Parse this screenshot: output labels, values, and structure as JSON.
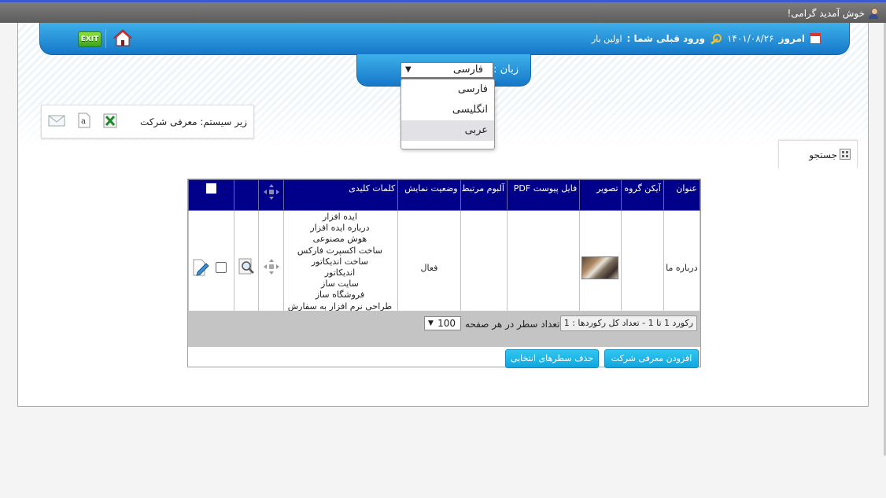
{
  "topbar": {
    "welcome": "خوش آمدید گرامی!"
  },
  "header": {
    "exit_label": "EXIT",
    "today_label": "امروز",
    "date": "۱۴۰۱/۰۸/۲۶",
    "last_login_label": "ورود قبلی شما :",
    "last_login_value": "اولین بار"
  },
  "language": {
    "label": "زبان :",
    "selected": "فارسی",
    "options": [
      "فارسی",
      "انگلیسی",
      "عربی"
    ],
    "highlighted_index": 2
  },
  "subsystem": {
    "text": "زیر سیستم: معرفی شرکت"
  },
  "search_tab": {
    "label": "جستجو"
  },
  "grid": {
    "columns": [
      "عنوان",
      "آیکن گروه",
      "تصویر",
      "فایل پیوست PDF",
      "آلبوم مرتبط",
      "وضعیت نمایش",
      "کلمات کلیدی"
    ],
    "rows": [
      {
        "title": "درباره ما",
        "status": "فعال",
        "keywords": [
          "ایده افزار",
          "درباره ایده افزار",
          "هوش مصنوعی",
          "ساخت اکسپرت فارکس",
          "ساخت اندیکاتور",
          "اندیکاتور",
          "سایت ساز",
          "فروشگاه ساز",
          "طراحی نرم افزار به سفارش مشتری"
        ]
      }
    ]
  },
  "pager": {
    "records_text": "رکورد 1 تا 1 - تعداد کل رکوردها : 1",
    "rows_per_page_label": "تعداد سطر در هر صفحه",
    "rows_per_page_value": "100"
  },
  "actions": {
    "add_label": "افزودن معرفی شرکت",
    "delete_label": "حذف سطرهای انتخابی"
  },
  "colors": {
    "header_blue": "#1678c8",
    "grid_header": "#00008b",
    "button": "#12a5e0"
  }
}
